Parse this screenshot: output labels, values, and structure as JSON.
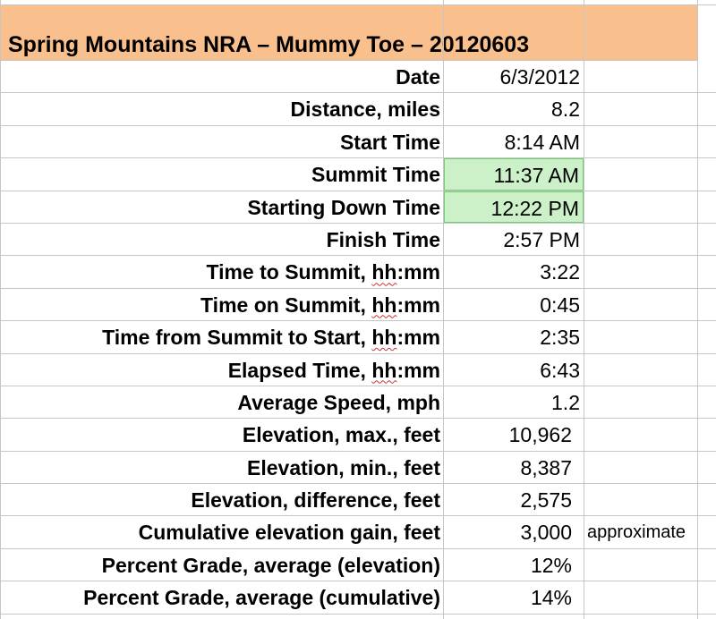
{
  "sheet": {
    "title": "Spring Mountains NRA – Mummy Toe – 20120603",
    "rows": [
      {
        "label": "Date",
        "value": "6/3/2012",
        "note": ""
      },
      {
        "label": "Distance, miles",
        "value": "8.2",
        "note": ""
      },
      {
        "label": "Start Time",
        "value": "8:14 AM",
        "note": ""
      },
      {
        "label": "Summit Time",
        "value": "11:37 AM",
        "note": ""
      },
      {
        "label": "Starting Down Time",
        "value": "12:22 PM",
        "note": ""
      },
      {
        "label": "Finish Time",
        "value": "2:57 PM",
        "note": ""
      },
      {
        "label_pre": "Time to Summit, ",
        "label_mark": "hh",
        "label_post": ":mm",
        "value": "3:22",
        "note": ""
      },
      {
        "label_pre": "Time on Summit, ",
        "label_mark": "hh",
        "label_post": ":mm",
        "value": "0:45",
        "note": ""
      },
      {
        "label_pre": "Time from Summit to Start, ",
        "label_mark": "hh",
        "label_post": ":mm",
        "value": "2:35",
        "note": ""
      },
      {
        "label_pre": "Elapsed Time, ",
        "label_mark": "hh",
        "label_post": ":mm",
        "value": "6:43",
        "note": ""
      },
      {
        "label": "Average Speed, mph",
        "value": "1.2",
        "note": ""
      },
      {
        "label": "Elevation, max., feet",
        "value": "10,962",
        "note": ""
      },
      {
        "label": "Elevation, min., feet",
        "value": "8,387",
        "note": ""
      },
      {
        "label": "Elevation, difference, feet",
        "value": "2,575",
        "note": ""
      },
      {
        "label": "Cumulative elevation gain, feet",
        "value": "3,000",
        "note": "approximate"
      },
      {
        "label": "Percent Grade, average (elevation)",
        "value": "12%",
        "note": ""
      },
      {
        "label": "Percent Grade, average (cumulative)",
        "value": "14%",
        "note": ""
      }
    ]
  },
  "colors": {
    "title_fill": "#f9c08e",
    "highlight_fill": "#ccf1c9",
    "highlight_border": "#6fcf72",
    "grid": "#c6c6c6"
  }
}
